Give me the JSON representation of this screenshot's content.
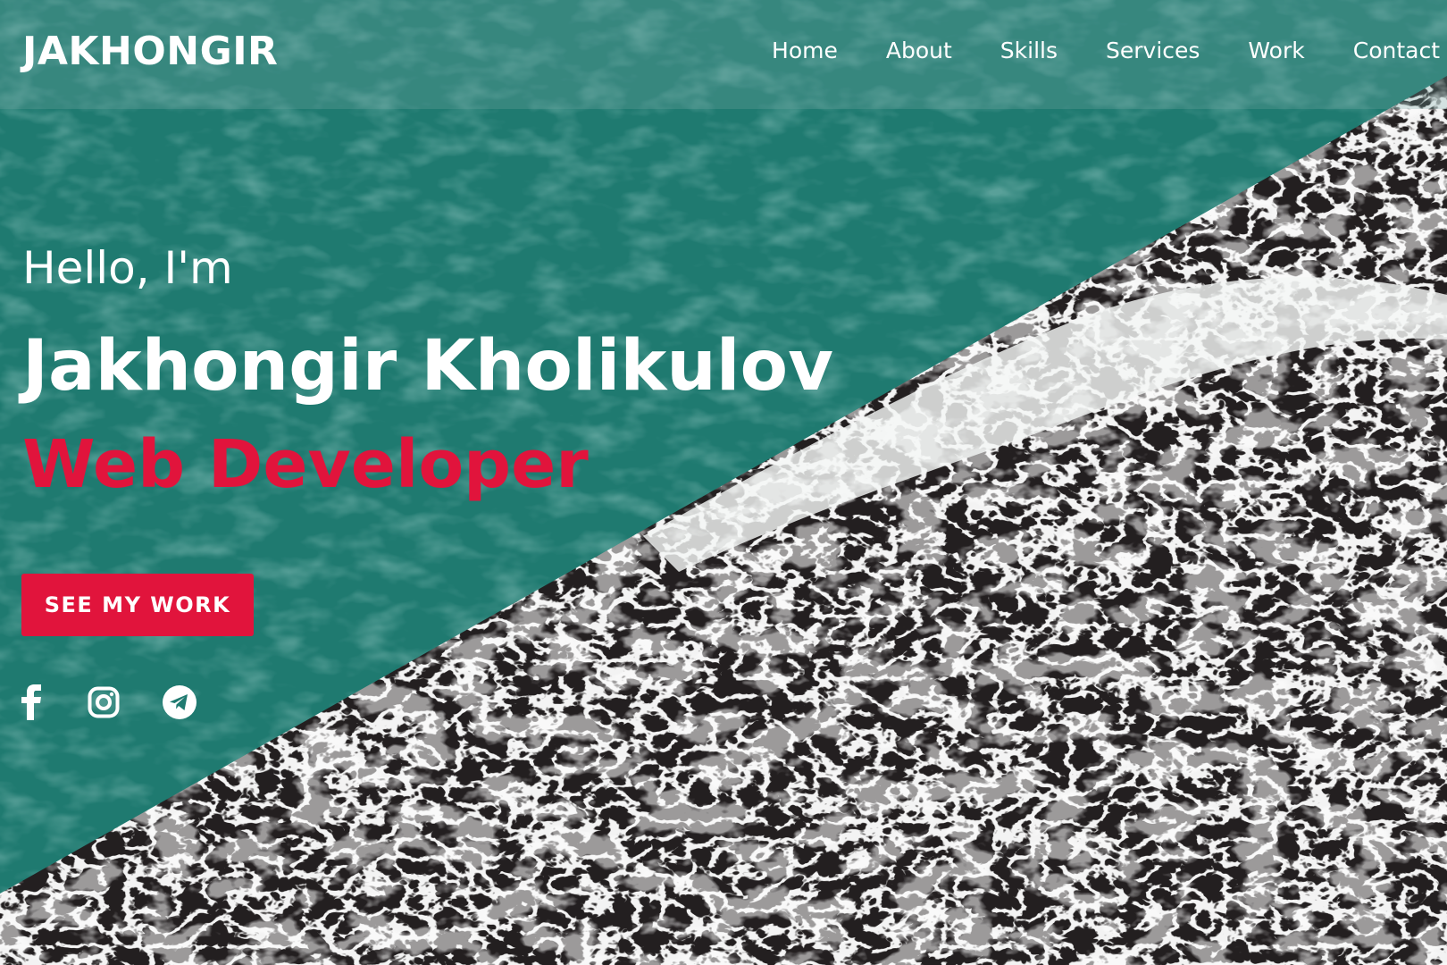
{
  "brand": {
    "logo": "JAKHONGIR"
  },
  "nav": {
    "items": [
      {
        "label": "Home"
      },
      {
        "label": "About"
      },
      {
        "label": "Skills"
      },
      {
        "label": "Services"
      },
      {
        "label": "Work"
      },
      {
        "label": "Contact"
      }
    ]
  },
  "hero": {
    "greeting": "Hello, I'm",
    "name": "Jakhongir Kholikulov",
    "role": "Web Developer",
    "cta_label": "SEE MY WORK",
    "social": [
      {
        "icon": "facebook-icon"
      },
      {
        "icon": "instagram-icon"
      },
      {
        "icon": "telegram-icon"
      }
    ]
  },
  "colors": {
    "teal_overlay": "#1f7a70",
    "accent": "#e1143c",
    "text": "#ffffff",
    "water_dark": "#231f20",
    "foam": "#ecefee"
  }
}
